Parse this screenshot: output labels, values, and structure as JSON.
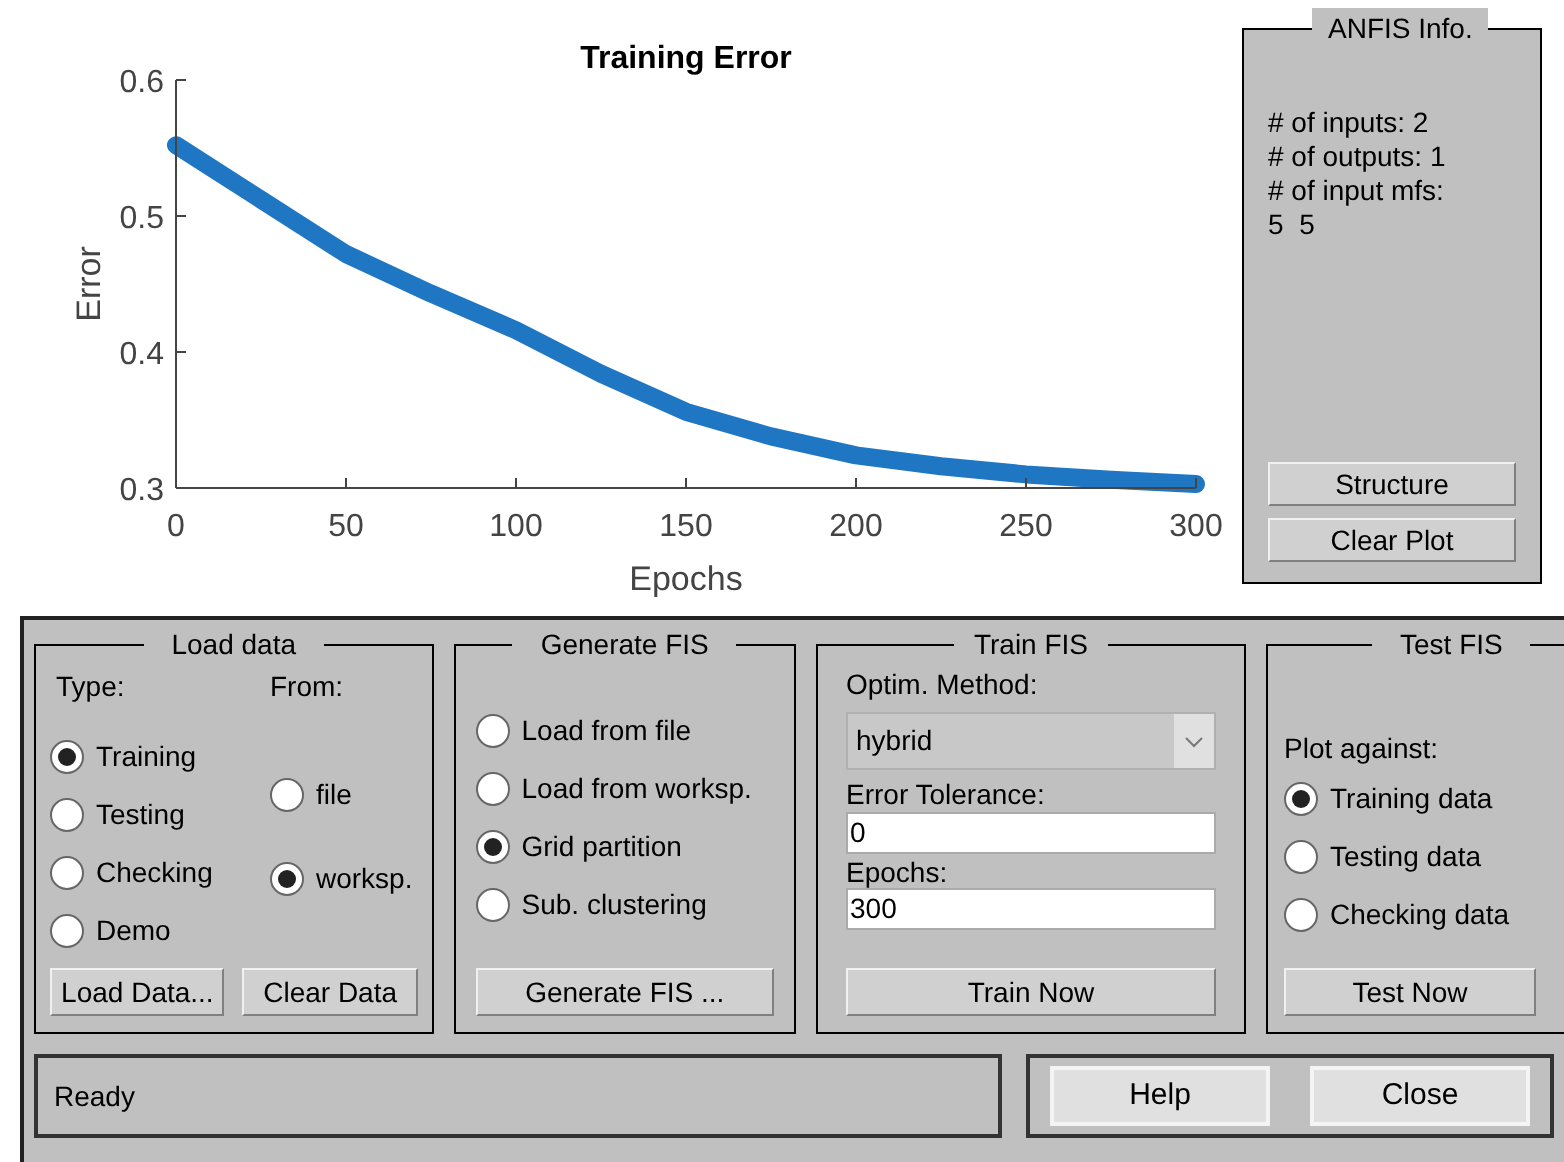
{
  "chart": {
    "chart_data": {
      "type": "line",
      "title": "Training Error",
      "xlabel": "Epochs",
      "ylabel": "Error",
      "x": [
        0,
        25,
        50,
        75,
        100,
        125,
        150,
        175,
        200,
        225,
        250,
        275,
        300
      ],
      "xlim": [
        0,
        300
      ],
      "ylim": [
        0.3,
        0.6
      ],
      "xticks": [
        0,
        50,
        100,
        150,
        200,
        250,
        300
      ],
      "yticks": [
        0.3,
        0.4,
        0.5,
        0.6
      ],
      "series": [
        {
          "color": "#1f77c4",
          "values": [
            0.552,
            0.512,
            0.472,
            0.443,
            0.416,
            0.384,
            0.356,
            0.338,
            0.324,
            0.316,
            0.31,
            0.306,
            0.303
          ]
        }
      ]
    }
  },
  "anfis_info": {
    "title": "ANFIS Info.",
    "lines": [
      "# of inputs: 2",
      "# of outputs: 1",
      "# of input mfs:",
      "5  5"
    ],
    "buttons": [
      "Structure",
      "Clear Plot"
    ]
  },
  "load_data": {
    "title": "Load data",
    "type_label": "Type:",
    "from_label": "From:",
    "types": [
      {
        "label": "Training",
        "selected": true
      },
      {
        "label": "Testing",
        "selected": false
      },
      {
        "label": "Checking",
        "selected": false
      },
      {
        "label": "Demo",
        "selected": false
      }
    ],
    "sources": [
      {
        "label": "file",
        "selected": false
      },
      {
        "label": "worksp.",
        "selected": true
      }
    ],
    "buttons": [
      "Load Data...",
      "Clear Data"
    ]
  },
  "generate_fis": {
    "title": "Generate FIS",
    "options": [
      {
        "label": "Load from file",
        "selected": false
      },
      {
        "label": "Load from worksp.",
        "selected": false
      },
      {
        "label": "Grid partition",
        "selected": true
      },
      {
        "label": "Sub. clustering",
        "selected": false
      }
    ],
    "button": "Generate FIS ..."
  },
  "train_fis": {
    "title": "Train FIS",
    "method_label": "Optim. Method:",
    "method": "hybrid",
    "tolerance_label": "Error Tolerance:",
    "tolerance": "0",
    "epochs_label": "Epochs:",
    "epochs": "300",
    "button": "Train Now"
  },
  "test_fis": {
    "title": "Test FIS",
    "plot_label": "Plot against:",
    "options": [
      {
        "label": "Training data",
        "selected": true
      },
      {
        "label": "Testing data",
        "selected": false
      },
      {
        "label": "Checking data",
        "selected": false
      }
    ],
    "button": "Test Now"
  },
  "status": "Ready",
  "buttons": [
    "Help",
    "Close"
  ]
}
